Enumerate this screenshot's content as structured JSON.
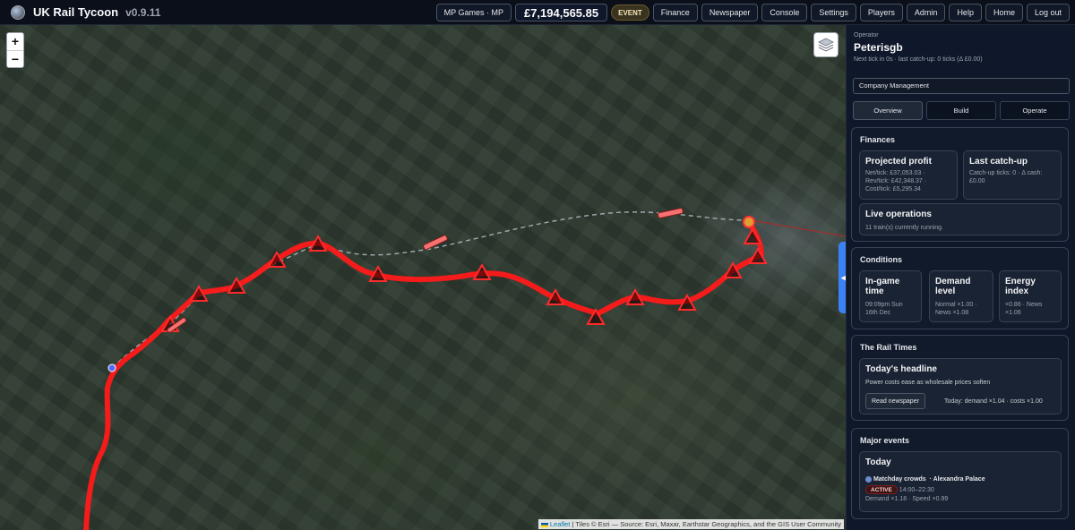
{
  "app": {
    "title": "UK Rail Tycoon",
    "version": "v0.9.11"
  },
  "topbar": {
    "mp_games": "MP Games · MP",
    "balance": "£7,194,565.85",
    "event": "EVENT",
    "nav": [
      "Finance",
      "Newspaper",
      "Console",
      "Settings",
      "Players",
      "Admin",
      "Help",
      "Home",
      "Log out"
    ]
  },
  "map": {
    "zoom_in": "+",
    "zoom_out": "−",
    "attribution_link": "Leaflet",
    "attribution_text": "| Tiles © Esri — Source: Esri, Maxar, Earthstar Geographics, and the GIS User Community",
    "route_color": "#ff1a1a"
  },
  "panel": {
    "operator_label": "Operator",
    "operator_name": "Peterisgb",
    "tick_info": "Next tick in 0s · last catch-up: 0 ticks (Δ £0.00)",
    "select_value": "Company Management",
    "tabs": [
      "Overview",
      "Build",
      "Operate"
    ],
    "finances": {
      "title": "Finances",
      "projected_title": "Projected profit",
      "projected_lines": [
        "Net/tick: £37,053.03 ·",
        "Rev/tick: £42,348.37 ·",
        "Cost/tick: £5,295.34"
      ],
      "catchup_title": "Last catch-up",
      "catchup_lines": [
        "Catch-up ticks: 0 · Δ cash:",
        "£0.00"
      ],
      "live_title": "Live operations",
      "live_text": "11 train(s) currently running."
    },
    "conditions": {
      "title": "Conditions",
      "time_title_1": "In-game",
      "time_title_2": "time",
      "time_lines": [
        "09:09pm Sun",
        "16th Dec"
      ],
      "demand_title_1": "Demand",
      "demand_title_2": "level",
      "demand_lines": [
        "Normal ×1.00 ·",
        "News ×1.08"
      ],
      "energy_title_1": "Energy",
      "energy_title_2": "index",
      "energy_lines": [
        "×0.86 · News",
        "×1.06"
      ]
    },
    "times": {
      "title": "The Rail Times",
      "headline_title": "Today's headline",
      "headline_text": "Power costs ease as wholesale prices soften",
      "read_button": "Read newspaper",
      "modifiers": "Today: demand ×1.04 · costs ×1.00"
    },
    "events": {
      "title": "Major events",
      "day": "Today",
      "event_name": "Matchday crowds",
      "event_place": "· Alexandra Palace",
      "status": "ACTIVE",
      "hours": "14:00–22:30",
      "effects": "Demand ×1.18 · Speed ×0.99"
    }
  }
}
